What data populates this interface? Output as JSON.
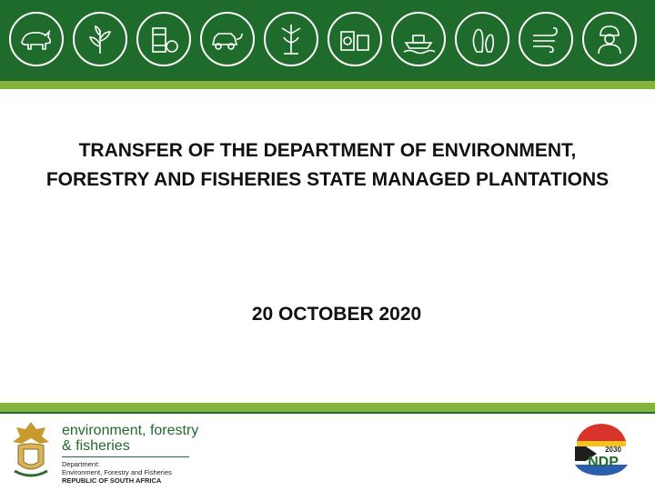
{
  "header": {
    "icons": [
      "rhino-icon",
      "tree-icon",
      "waste-barrel-icon",
      "car-charging-icon",
      "windmill-plant-icon",
      "recycling-containers-icon",
      "fishing-boat-icon",
      "penguin-icon",
      "wind-icon",
      "worker-icon"
    ]
  },
  "slide": {
    "title": "TRANSFER OF THE DEPARTMENT OF ENVIRONMENT, FORESTRY AND FISHERIES STATE MANAGED PLANTATIONS",
    "date": "20 OCTOBER 2020"
  },
  "footer": {
    "brand_line1": "environment, forestry",
    "brand_line2": "& fisheries",
    "department_label": "Department:",
    "department_name": "Environment, Forestry and Fisheries",
    "country": "REPUBLIC OF SOUTH AFRICA",
    "ndp_year": "2030",
    "ndp_text": "NDP"
  },
  "colors": {
    "green_dark": "#1f6b2c",
    "green_light": "#84b43c",
    "white": "#ffffff"
  }
}
